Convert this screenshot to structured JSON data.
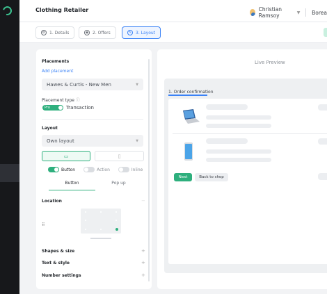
{
  "app": {
    "title": "Clothing Retailer"
  },
  "user": {
    "name": "Christian Ramsoy",
    "org_partial": "Borea"
  },
  "steps": [
    {
      "label": "1. Details",
      "icon": "settings-icon",
      "active": false
    },
    {
      "label": "2. Offers",
      "icon": "offers-icon",
      "active": false
    },
    {
      "label": "3. Layout",
      "icon": "pencil-icon",
      "active": true
    }
  ],
  "placements": {
    "heading": "Placements",
    "add_link": "Add placement",
    "selected": "Hawes & Curtis - New Men",
    "type_label": "Placement type",
    "pro_badge": "Pro",
    "transaction_label": "Transaction"
  },
  "layout": {
    "heading": "Layout",
    "selected": "Own layout",
    "devices": [
      "desktop-icon",
      "mobile-icon"
    ],
    "types": [
      {
        "label": "Button",
        "on": true
      },
      {
        "label": "Action",
        "on": false
      },
      {
        "label": "Inline",
        "on": false
      }
    ],
    "subtabs": [
      "Button",
      "Pop up"
    ],
    "active_subtab": "Button"
  },
  "location": {
    "heading": "Location"
  },
  "sections": [
    "Shapes & size",
    "Text & style",
    "Number settings"
  ],
  "preview": {
    "title": "Live Preview",
    "tab": "1. Order confirmation",
    "next_button": "Next",
    "back_button": "Back to shop"
  },
  "colors": {
    "accent": "#2eaf7d",
    "primary": "#3b82f6",
    "sidebar": "#17181b"
  }
}
